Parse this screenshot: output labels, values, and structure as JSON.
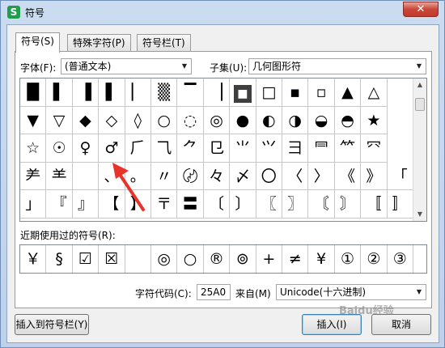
{
  "window": {
    "icon_glyph": "S",
    "title": "符号",
    "close_glyph": "✕"
  },
  "tabs": [
    {
      "label": "符号(S)",
      "active": true
    },
    {
      "label": "特殊字符(P)",
      "active": false
    },
    {
      "label": "符号栏(T)",
      "active": false
    }
  ],
  "font": {
    "label": "字体(F):",
    "value": "(普通文本)"
  },
  "subset": {
    "label": "子集(U):",
    "value": "几何图形符"
  },
  "symbol_grid": {
    "columns": 15,
    "selected_index": 9,
    "rows": [
      [
        "█",
        "▌",
        "▐",
        "▌",
        "▏",
        "▒",
        "▔",
        "▕",
        "■",
        "□",
        "▪",
        "▫",
        "▲",
        "△"
      ],
      [
        "▼",
        "▽",
        "◆",
        "◇",
        "◊",
        "○",
        "◌",
        "◎",
        "●",
        "◐",
        "◑",
        "◒",
        "◓",
        "★"
      ],
      [
        "☆",
        "☉",
        "♀",
        "♂",
        "⺁",
        "⺄",
        "⺈",
        "⺋",
        "⺌",
        "⺍",
        "⺕",
        "⺜",
        "⺮",
        "⺳"
      ],
      [
        "⺶",
        "⺷",
        "",
        "、",
        "。",
        "〃",
        "〄",
        "々",
        "〆",
        "〇",
        "〈",
        "〉",
        "《",
        "》",
        "「"
      ],
      [
        "」",
        "『",
        "』",
        "【",
        "】",
        "〒",
        "〓",
        "〔",
        "〕",
        "〖",
        "〗",
        "〘",
        "〙",
        "〚",
        "〛"
      ]
    ]
  },
  "recent": {
    "label": "近期使用过的符号(R):",
    "symbols": [
      "￥",
      "§",
      "☑",
      "☒",
      "",
      "◎",
      "○",
      "®",
      "⊚",
      "+",
      "≠",
      "¥",
      "①",
      "②",
      "③"
    ]
  },
  "char_code": {
    "label": "字符代码(C):",
    "value": "25A0"
  },
  "from": {
    "label": "来自(M)",
    "value": "Unicode(十六进制)"
  },
  "buttons": {
    "insert_to_bar": "插入到符号栏(Y)",
    "insert": "插入(I)",
    "cancel": "取消"
  },
  "watermark": "Baidu经验",
  "colors": {
    "annotation_arrow": "#e8332a"
  }
}
